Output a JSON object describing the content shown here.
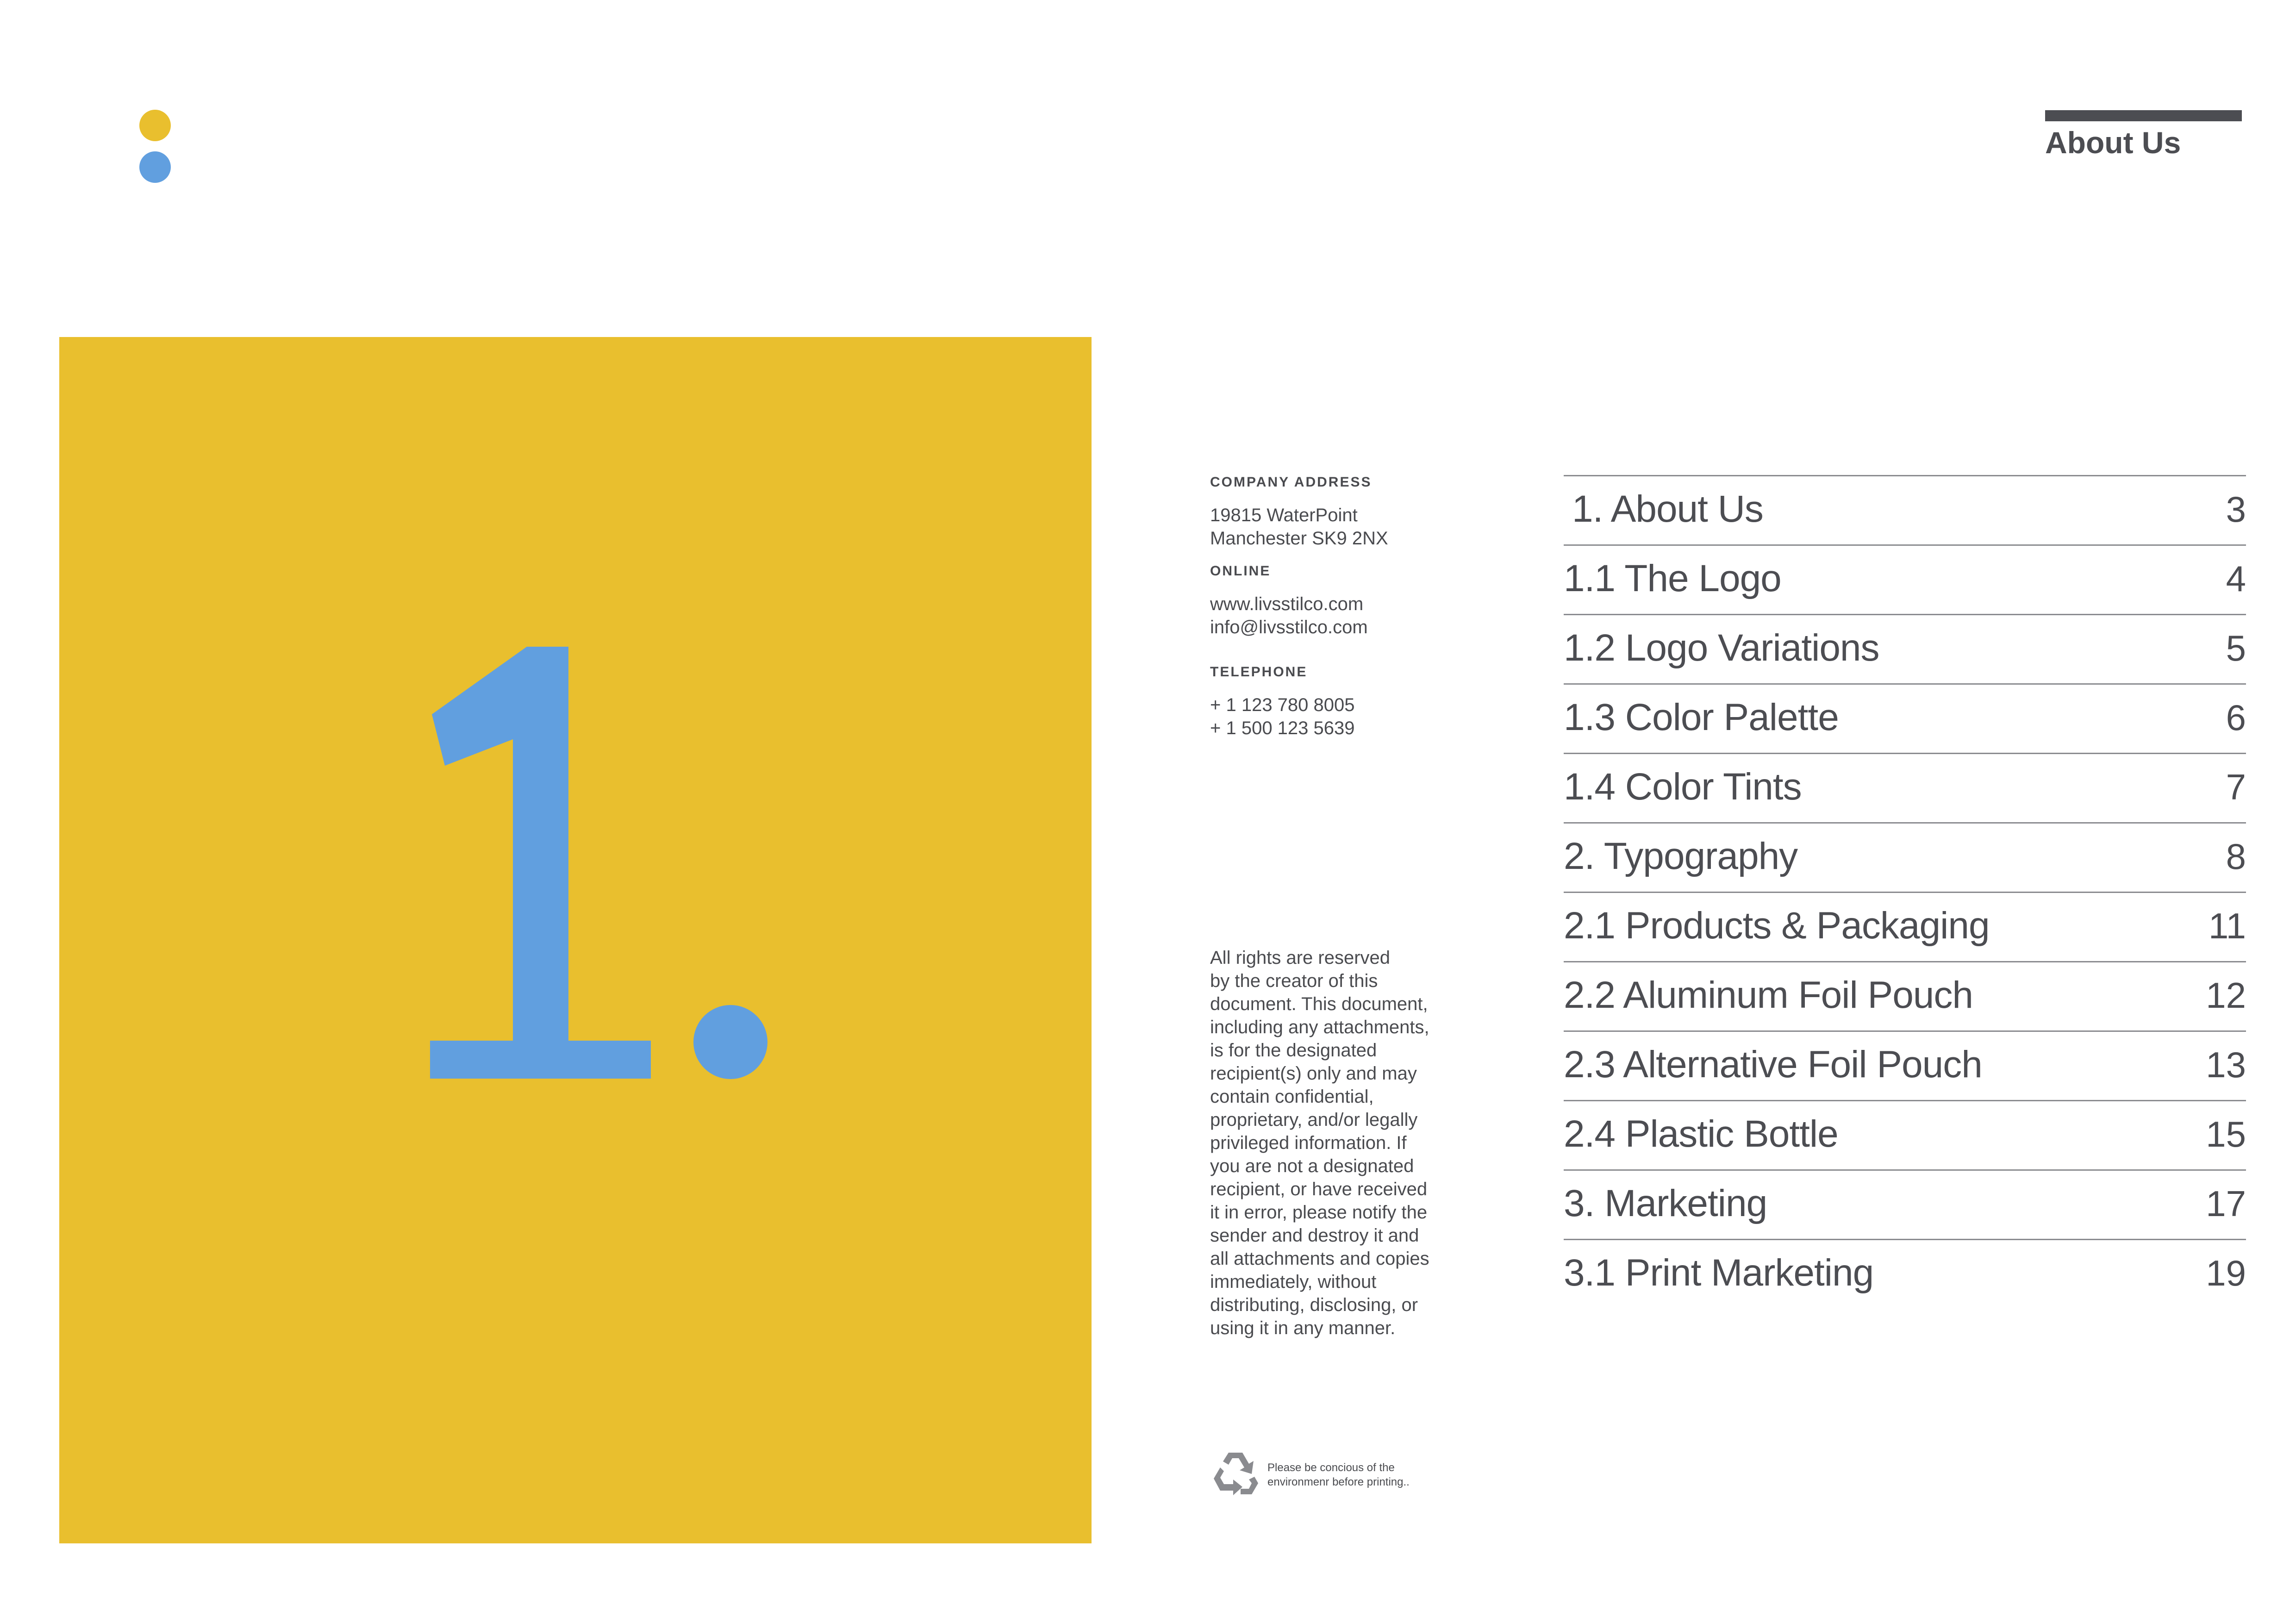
{
  "colors": {
    "brand_yellow": "#e9bf2e",
    "brand_blue": "#619fdf",
    "text_dark": "#4c4d52"
  },
  "header": {
    "section_title": "About Us"
  },
  "chapter": {
    "number": "1",
    "dot": "."
  },
  "contact": {
    "address_label": "COMPANY ADDRESS",
    "address_line1": "19815 WaterPoint",
    "address_line2": "Manchester SK9 2NX",
    "online_label": "ONLINE",
    "website": "www.livsstilco.com",
    "email": "info@livsstilco.com",
    "telephone_label": "TELEPHONE",
    "phone1": "+ 1 123 780 8005",
    "phone2": "+ 1 500 123 5639"
  },
  "disclaimer": {
    "lines": [
      "All rights are reserved",
      "by the creator of this",
      "document. This document,",
      "including any attachments,",
      "is for the designated",
      "recipient(s) only and may",
      "contain confidential,",
      "proprietary, and/or legally",
      "privileged information. If",
      "you are not a designated",
      "recipient, or have received",
      "it in error, please notify the",
      "sender and destroy it and",
      "all attachments and copies",
      "immediately, without",
      "distributing, disclosing, or",
      "using it in any manner."
    ]
  },
  "environment_note": {
    "icon": "recycle-icon",
    "line1": "Please be concious of the",
    "line2": "environmenr before printing.."
  },
  "toc": [
    {
      "title": "1. About Us",
      "page": "3"
    },
    {
      "title": "1.1 The Logo",
      "page": "4"
    },
    {
      "title": "1.2 Logo Variations",
      "page": "5"
    },
    {
      "title": "1.3 Color Palette",
      "page": "6"
    },
    {
      "title": "1.4 Color Tints",
      "page": "7"
    },
    {
      "title": "2. Typography",
      "page": "8"
    },
    {
      "title": "2.1 Products & Packaging",
      "page": "11"
    },
    {
      "title": "2.2 Aluminum Foil Pouch",
      "page": "12"
    },
    {
      "title": "2.3 Alternative Foil Pouch",
      "page": "13"
    },
    {
      "title": "2.4 Plastic Bottle",
      "page": "15"
    },
    {
      "title": "3. Marketing",
      "page": "17"
    },
    {
      "title": "3.1 Print Marketing",
      "page": "19"
    }
  ]
}
